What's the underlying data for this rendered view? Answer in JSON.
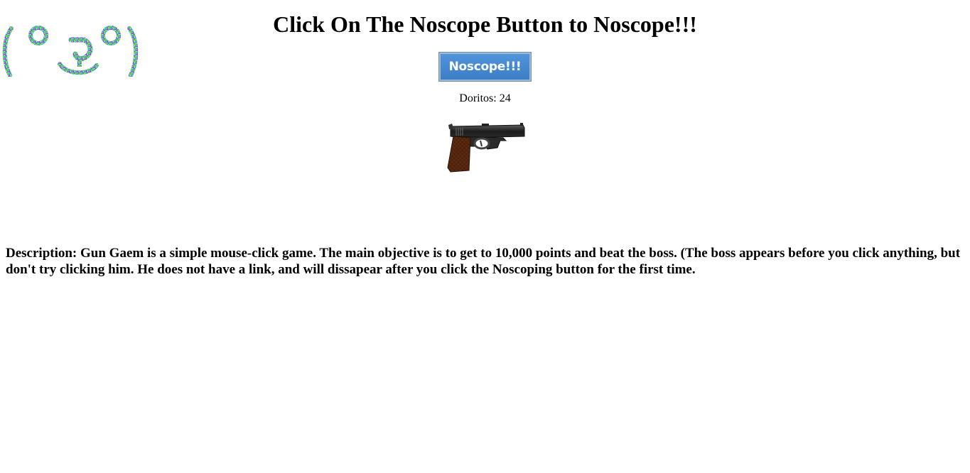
{
  "header": {
    "title": "Click On The Noscope Button to Noscope!!!"
  },
  "game": {
    "button_label": "Noscope!!!",
    "score_label": "Doritos: ",
    "score_value": "24",
    "weapon_icon": "pistol-icon",
    "boss_icon": "lenny-face-icon"
  },
  "description": {
    "text": "Description: Gun Gaem is a simple mouse-click game. The main objective is to get to 10,000 points and beat the boss. (The boss appears before you click anything, but don't try clicking him. He does not have a link, and will dissapear after you click the Noscoping button for the first time."
  },
  "colors": {
    "button_bg": "#4388d0",
    "button_text": "#ffffff",
    "background": "#ffffff"
  }
}
